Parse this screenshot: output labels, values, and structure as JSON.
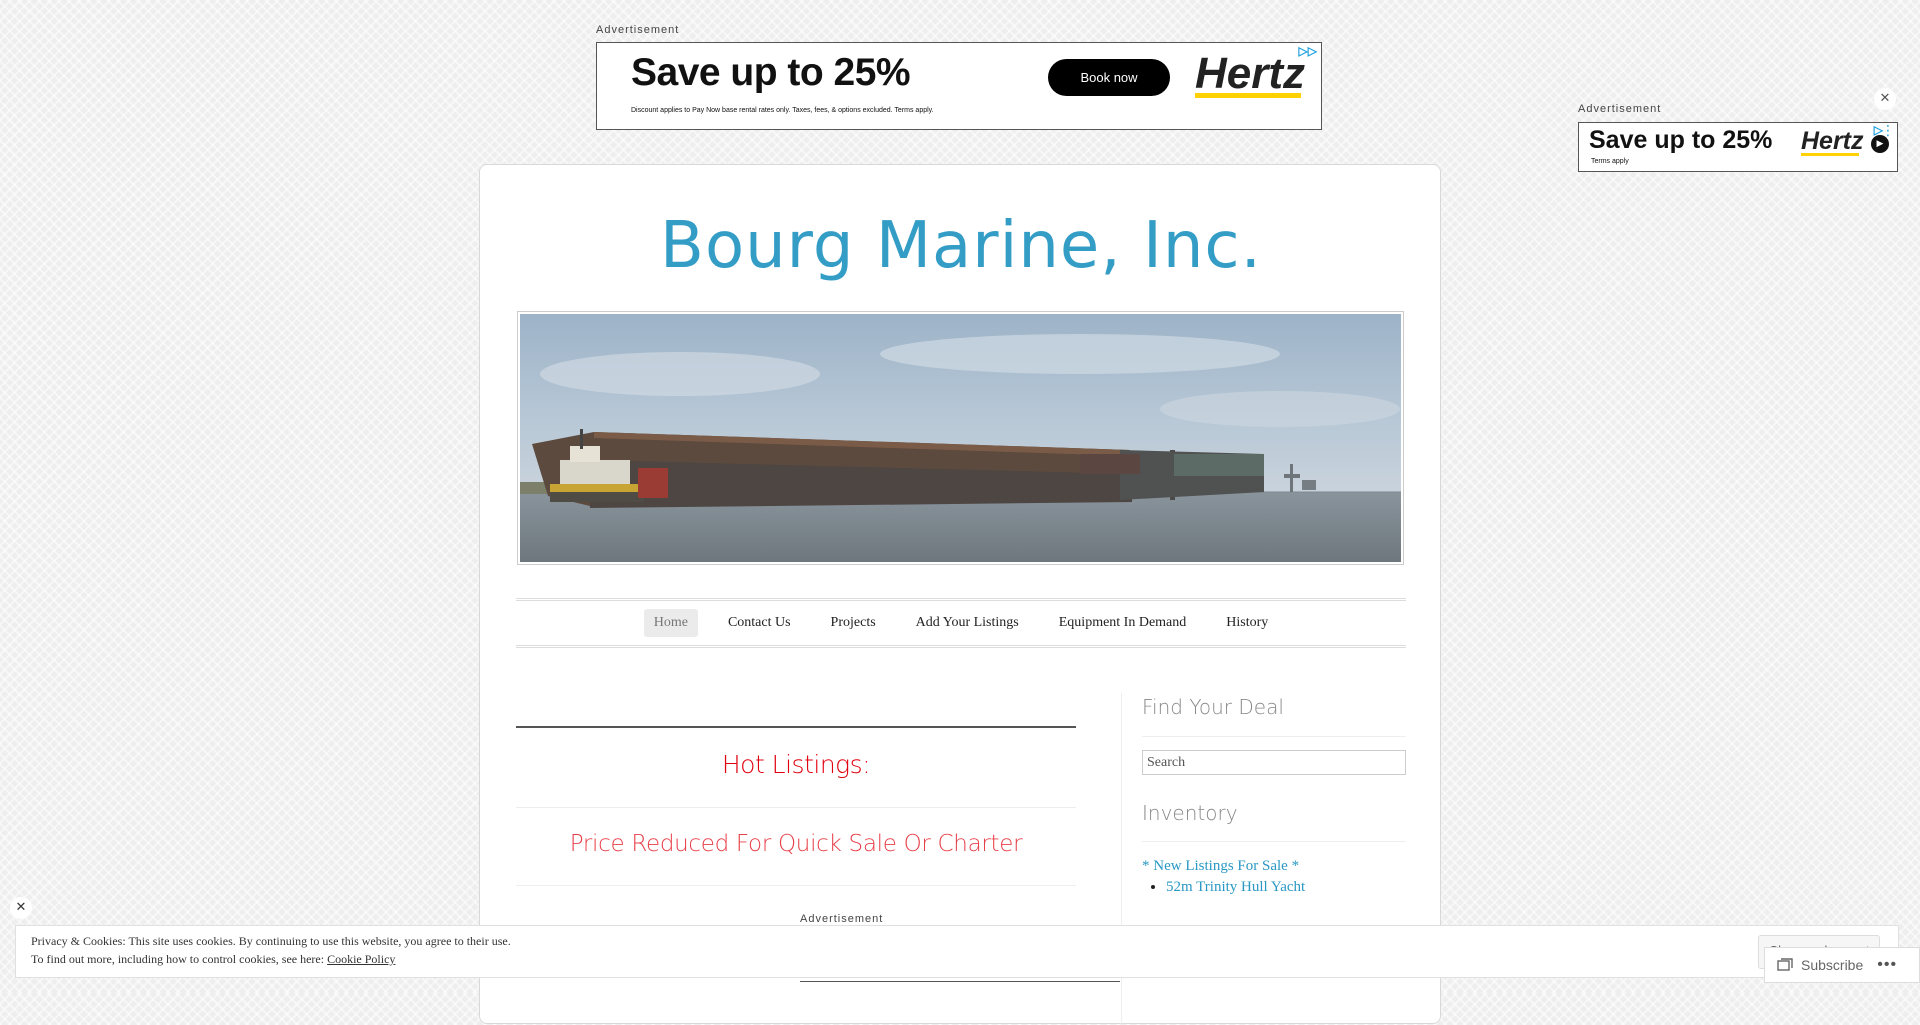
{
  "ads": {
    "label": "Advertisement",
    "top": {
      "headline": "Save up to 25%",
      "fine_print": "Discount applies to Pay Now base rental rates only. Taxes, fees, & options excluded. Terms apply.",
      "button": "Book now",
      "brand": "Hertz"
    },
    "side": {
      "headline": "Save up to 25%",
      "fine_print": "Terms apply",
      "brand": "Hertz"
    }
  },
  "site": {
    "title": "Bourg Marine, Inc."
  },
  "nav": {
    "items": [
      {
        "label": "Home",
        "active": true
      },
      {
        "label": "Contact Us"
      },
      {
        "label": "Projects"
      },
      {
        "label": "Add Your Listings"
      },
      {
        "label": "Equipment In Demand"
      },
      {
        "label": "History"
      }
    ]
  },
  "main": {
    "hot_title": "Hot Listings:",
    "deal_title": "Price Reduced For Quick Sale Or Charter"
  },
  "sidebar": {
    "find_title": "Find Your Deal",
    "search_placeholder": "Search",
    "inventory_title": "Inventory",
    "category_link": "* New Listings For Sale *",
    "items": [
      "52m Trinity Hull Yacht"
    ]
  },
  "cookie": {
    "line1": "Privacy & Cookies: This site uses cookies. By continuing to use this website, you agree to their use.",
    "line2_prefix": "To find out more, including how to control cookies, see here: ",
    "line2_link": "Cookie Policy",
    "button": "Close and accept"
  },
  "subscribe": {
    "label": "Subscribe",
    "more": "•••"
  },
  "colors": {
    "accent": "#2a98c4",
    "hot": "#e0000e",
    "brand_yellow": "#ffd100"
  },
  "icons": [
    "close-icon",
    "adchoices-icon",
    "subscribe-icon",
    "more-icon"
  ]
}
